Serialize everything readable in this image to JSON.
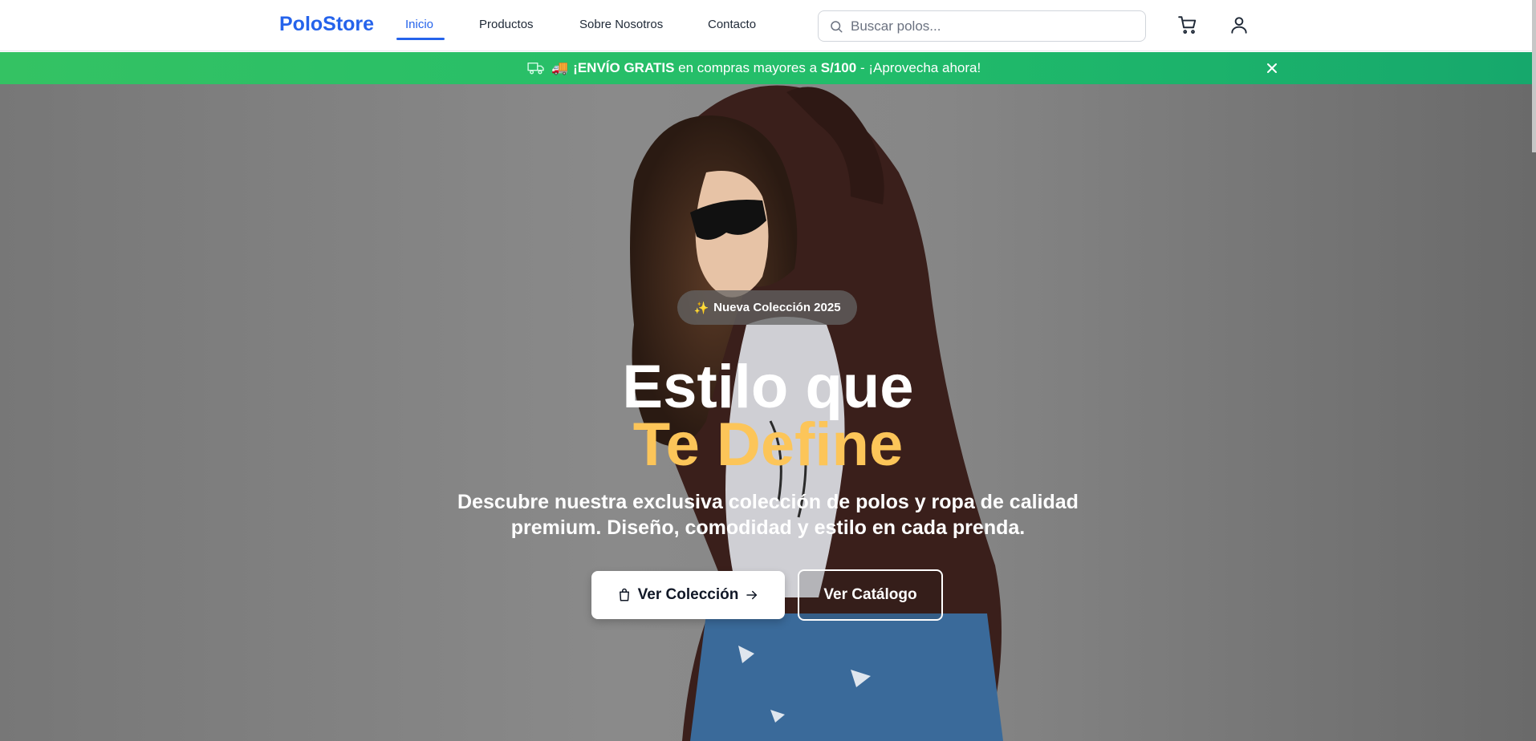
{
  "header": {
    "logo": "PoloStore",
    "nav": [
      {
        "label": "Inicio",
        "active": true
      },
      {
        "label": "Productos",
        "active": false
      },
      {
        "label": "Sobre Nosotros",
        "active": false
      },
      {
        "label": "Contacto",
        "active": false
      }
    ],
    "search": {
      "placeholder": "Buscar polos...",
      "value": ""
    },
    "icons": [
      "cart-icon",
      "user-icon"
    ]
  },
  "promo": {
    "emoji": "🚚",
    "highlight": "¡ENVÍO GRATIS",
    "text_mid": " en compras mayores a ",
    "amount": "S/100",
    "text_end": " - ¡Aprovecha ahora!",
    "close_icon": "close-icon"
  },
  "hero": {
    "badge": "Nueva Colección 2025",
    "badge_icon": "✨",
    "title_line1": "Estilo que",
    "title_line2": "Te Define",
    "subtitle": "Descubre nuestra exclusiva colección de polos y ropa de calidad premium. Diseño, comodidad y estilo en cada prenda.",
    "primary_button": "Ver Colección",
    "secondary_button": "Ver Catálogo"
  },
  "colors": {
    "brand": "#2563eb",
    "promo_green": "#22bd6a",
    "accent_gold": "#fcc559"
  }
}
